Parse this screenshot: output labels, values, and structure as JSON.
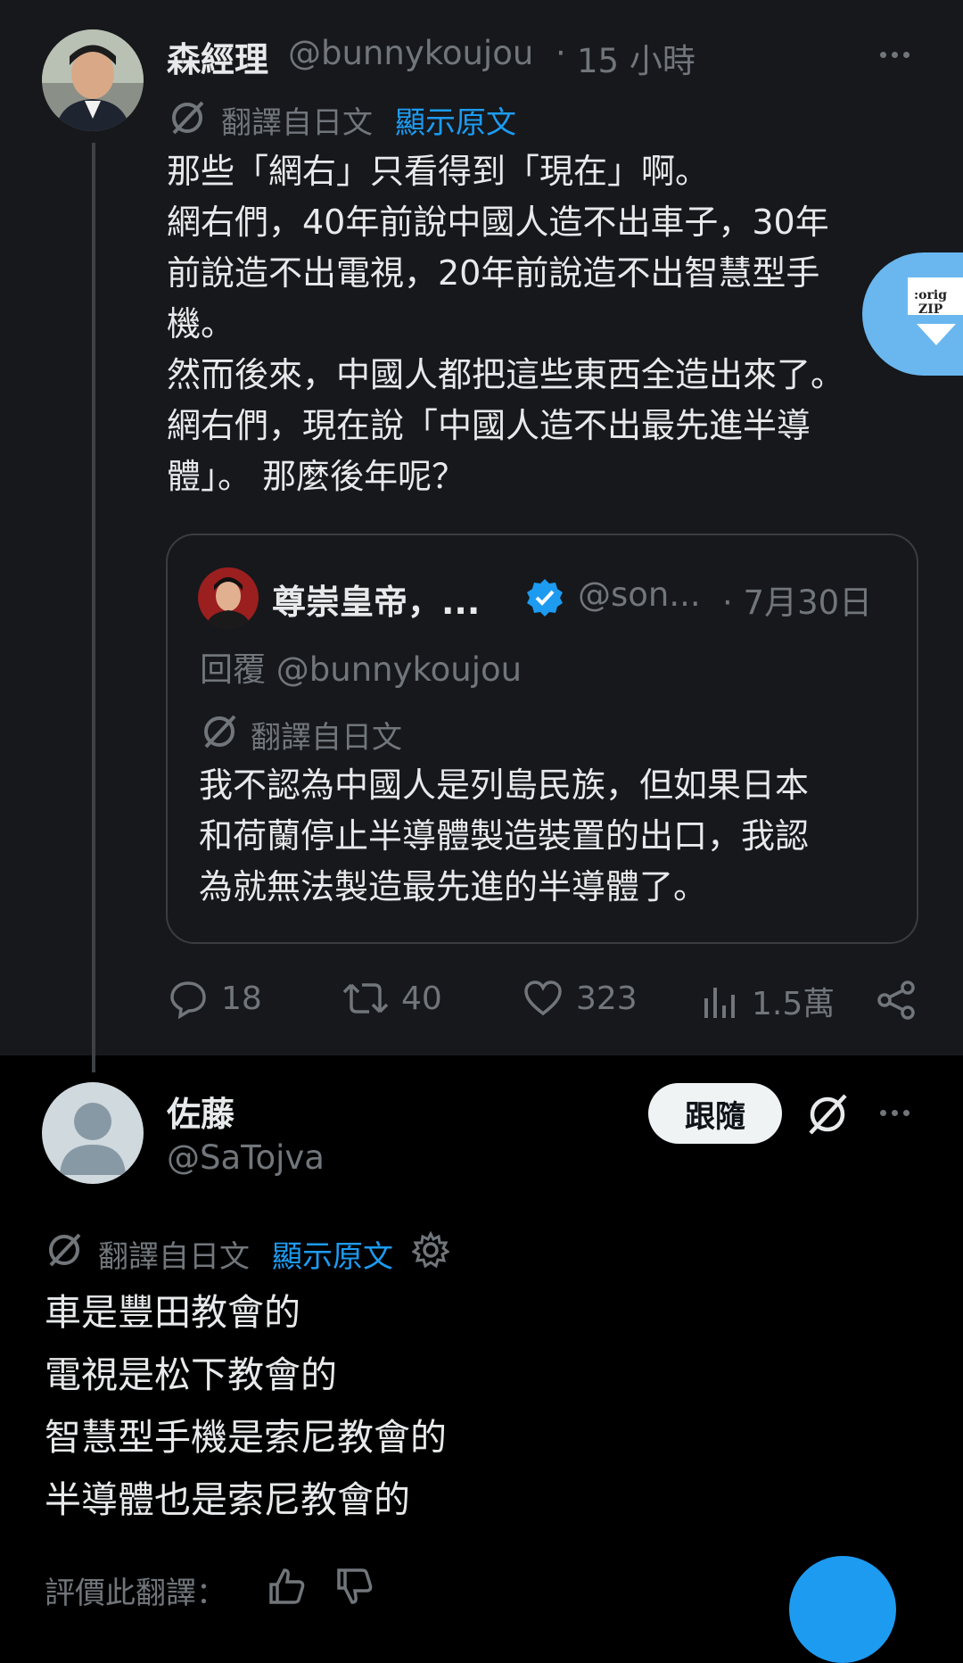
{
  "quoted_post": {
    "display_name": "森經理",
    "handle": "@bunnykoujou",
    "separator": "·",
    "time": "15 小時",
    "translated_from": "翻譯自日文",
    "show_original": "顯示原文",
    "text_lines": [
      "那些「網右」只看得到「現在」啊。",
      "網右們，40年前說中國人造不出車子，30年",
      "前說造不出電視，20年前說造不出智慧型手",
      "機。",
      "然而後來，中國人都把這些東西全造出來了。",
      "網右們，現在說「中國人造不出最先進半導",
      "體」。 那麼後年呢？"
    ],
    "quote": {
      "display_name": "尊崇皇帝，...",
      "handle": "@son...",
      "date": "· 7月30日",
      "reply_to": "回覆 @bunnykoujou",
      "translated_from": "翻譯自日文",
      "text_lines": [
        "我不認為中國人是列島民族，但如果日本",
        "和荷蘭停止半導體製造裝置的出口，我認",
        "為就無法製造最先進的半導體了。"
      ]
    },
    "actions": {
      "replies": "18",
      "reposts": "40",
      "likes": "323",
      "views": "1.5萬"
    }
  },
  "main_post": {
    "display_name": "佐藤",
    "handle": "@SaTojva",
    "follow_label": "跟隨",
    "translated_from": "翻譯自日文",
    "show_original": "顯示原文",
    "text_lines": [
      "車是豐田教會的",
      "電視是松下教會的",
      "智慧型手機是索尼教會的",
      "半導體也是索尼教會的"
    ],
    "rate_translation": "評價此翻譯："
  },
  "overlay": {
    "zip_line1": ":orig",
    "zip_line2": "ZIP"
  },
  "colors": {
    "background": "#000000",
    "panel": "#16181c",
    "accent": "#1d9bf0",
    "muted": "#71767b",
    "text": "#e7e9ea"
  }
}
